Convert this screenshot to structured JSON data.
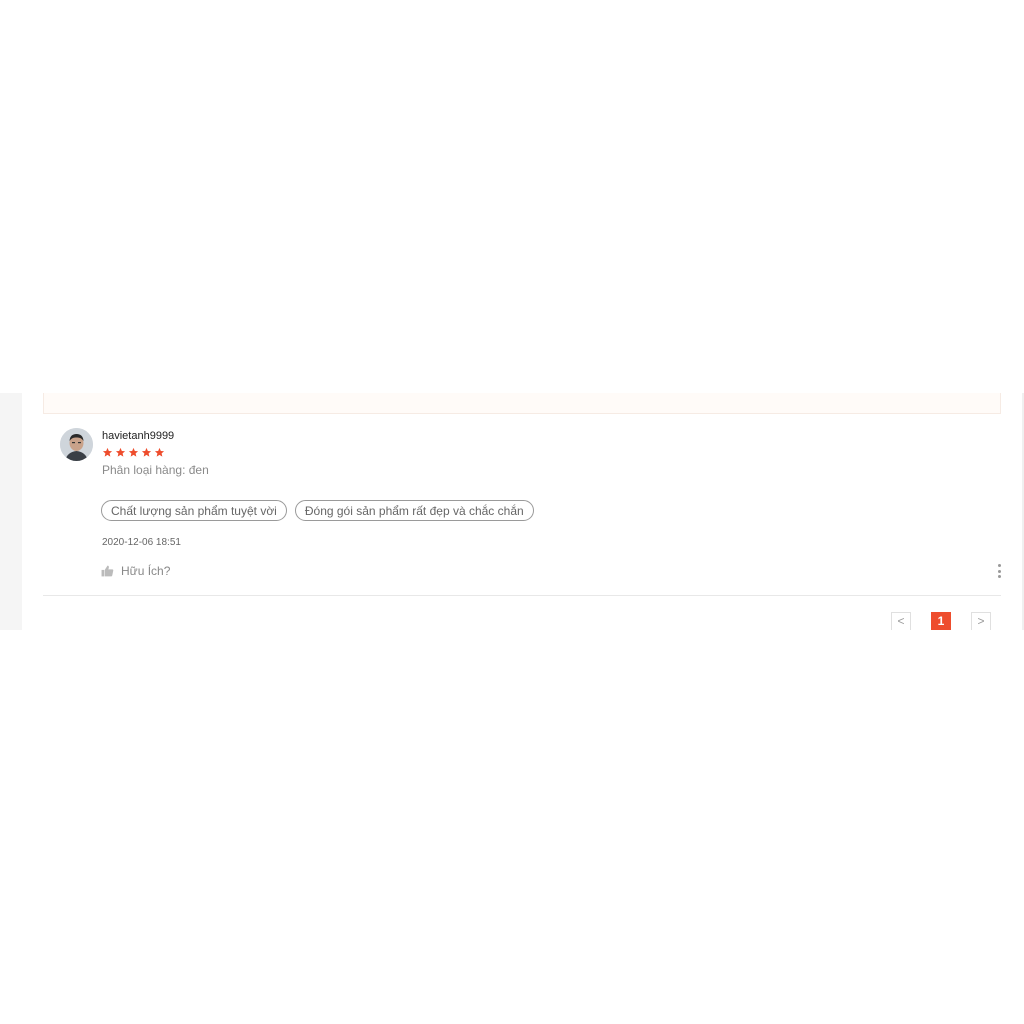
{
  "review": {
    "username": "havietanh9999",
    "rating": 5,
    "variation": "Phân loại hàng: đen",
    "tags": [
      "Chất lượng sản phẩm tuyệt vời",
      "Đóng gói sản phẩm rất đẹp và chắc chắn"
    ],
    "timestamp": "2020-12-06 18:51",
    "helpful_label": "Hữu Ích?"
  },
  "pagination": {
    "prev": "<",
    "current": "1",
    "next": ">"
  },
  "colors": {
    "accent": "#ee4d2d",
    "star": "#ee4d2d"
  }
}
